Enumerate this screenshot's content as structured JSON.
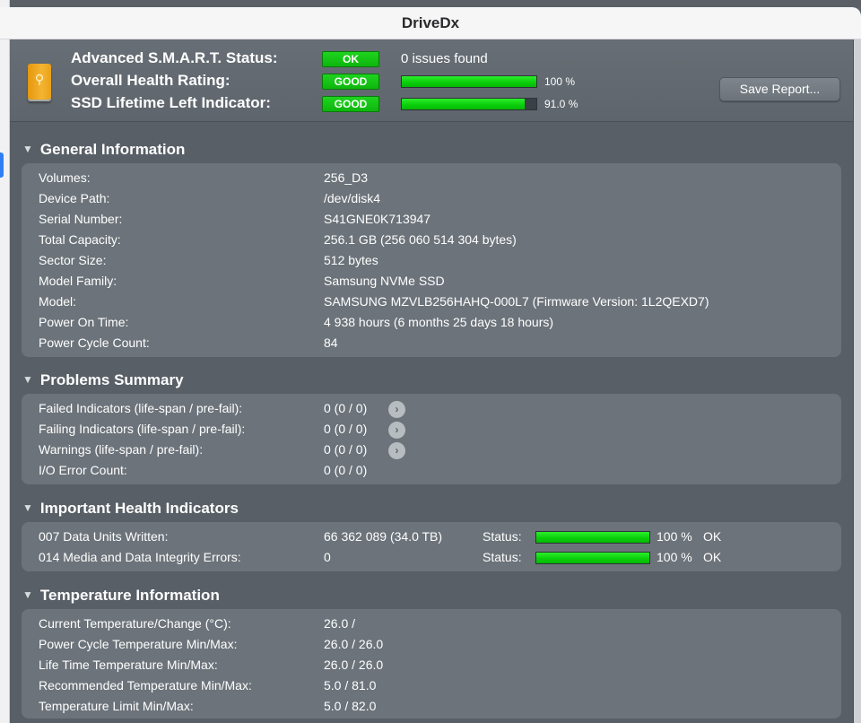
{
  "app": {
    "title": "DriveDx"
  },
  "header": {
    "rows": [
      {
        "label": "Advanced S.M.A.R.T. Status:",
        "badge": "OK",
        "text": "0 issues found"
      },
      {
        "label": "Overall Health Rating:",
        "badge": "GOOD",
        "percent_text": "100 %",
        "level": 100
      },
      {
        "label": "SSD Lifetime Left Indicator:",
        "badge": "GOOD",
        "percent_text": "91.0 %",
        "level": 91
      }
    ],
    "save_button": "Save Report...",
    "icon": "drive-icon"
  },
  "general": {
    "title": "General Information",
    "rows": [
      {
        "label": "Volumes:",
        "value": "256_D3"
      },
      {
        "label": "Device Path:",
        "value": "/dev/disk4"
      },
      {
        "label": "Serial Number:",
        "value": "S41GNE0K713947"
      },
      {
        "label": "Total Capacity:",
        "value": "256.1 GB (256 060 514 304 bytes)"
      },
      {
        "label": "Sector Size:",
        "value": "512 bytes"
      },
      {
        "label": "Model Family:",
        "value": "Samsung NVMe SSD"
      },
      {
        "label": "Model:",
        "value": "SAMSUNG MZVLB256HAHQ-000L7  (Firmware Version: 1L2QEXD7)"
      },
      {
        "label": "Power On Time:",
        "value": "4 938 hours (6 months 25 days 18 hours)"
      },
      {
        "label": "Power Cycle Count:",
        "value": "84"
      }
    ]
  },
  "problems": {
    "title": "Problems Summary",
    "rows": [
      {
        "label": "Failed Indicators (life-span / pre-fail):",
        "value": "0 (0 / 0)"
      },
      {
        "label": "Failing Indicators (life-span / pre-fail):",
        "value": "0 (0 / 0)"
      },
      {
        "label": "Warnings (life-span / pre-fail):",
        "value": "0 (0 / 0)"
      },
      {
        "label": "I/O Error Count:",
        "value": "0 (0 / 0)"
      }
    ]
  },
  "health": {
    "title": "Important Health Indicators",
    "status_label": "Status:",
    "rows": [
      {
        "label": "007  Data Units Written:",
        "value": "66 362 089 (34.0 TB)",
        "percent_text": "100 %",
        "level": 100,
        "state": "OK"
      },
      {
        "label": "014  Media and Data Integrity Errors:",
        "value": "0",
        "percent_text": "100 %",
        "level": 100,
        "state": "OK"
      }
    ]
  },
  "temperature": {
    "title": "Temperature Information",
    "rows": [
      {
        "label": "Current Temperature/Change (°C):",
        "value": "26.0 /"
      },
      {
        "label": "Power Cycle Temperature Min/Max:",
        "value": "26.0 / 26.0"
      },
      {
        "label": "Life Time Temperature Min/Max:",
        "value": "26.0 / 26.0"
      },
      {
        "label": "Recommended Temperature Min/Max:",
        "value": "5.0   / 81.0"
      },
      {
        "label": "Temperature Limit Min/Max:",
        "value": "5.0   / 82.0"
      }
    ]
  },
  "colors": {
    "accent_green": "#0bd00b",
    "panel_bg": "#6c737a",
    "window_bg": "#585f66"
  }
}
